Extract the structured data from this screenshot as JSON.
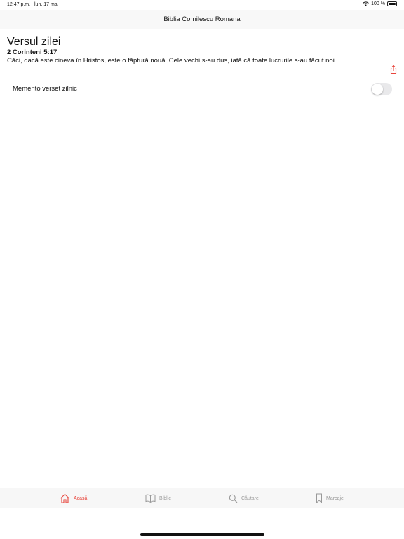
{
  "status_bar": {
    "time": "12:47 p.m.",
    "date": "lun. 17 mai",
    "battery": "100 %"
  },
  "nav": {
    "title": "Biblia Cornilescu Romana"
  },
  "verse": {
    "heading": "Versul zilei",
    "reference": "2 Corinteni 5:17",
    "text": "Căci, dacă este cineva în Hristos, este o făptură nouă. Cele vechi s-au dus, iată că toate lucrurile s-au făcut noi."
  },
  "reminder": {
    "label": "Memento verset zilnic",
    "enabled": false
  },
  "tabs": [
    {
      "label": "Acasă",
      "icon": "home-icon",
      "active": true
    },
    {
      "label": "Biblie",
      "icon": "book-icon",
      "active": false
    },
    {
      "label": "Căutare",
      "icon": "search-icon",
      "active": false
    },
    {
      "label": "Marcaje",
      "icon": "bookmark-icon",
      "active": false
    }
  ],
  "colors": {
    "accent": "#e8453c",
    "inactive": "#999999"
  }
}
